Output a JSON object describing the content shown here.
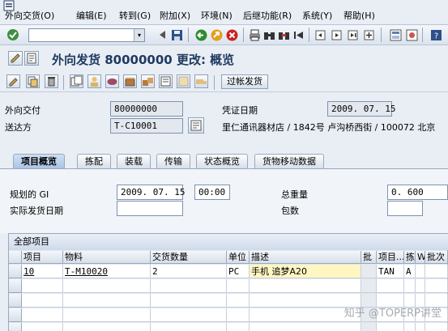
{
  "menu": [
    "外向交货(O)",
    "编辑(E)",
    "转到(G)",
    "附加(X)",
    "环境(N)",
    "后继功能(R)",
    "系统(Y)",
    "帮助(H)"
  ],
  "title": "外向发货 80000000 更改: 概览",
  "app_toolbar": {
    "post_goods_issue": "过帐发货"
  },
  "header": {
    "delivery_label": "外向交付",
    "delivery_value": "80000000",
    "shipto_label": "送达方",
    "shipto_value": "T-C10001",
    "docdate_label": "凭证日期",
    "docdate_value": "2009. 07. 15",
    "address": "里仁通讯器材店 / 1842号 卢沟桥西街 / 100072 北京"
  },
  "tabs": [
    "项目概览",
    "拣配",
    "装载",
    "传输",
    "状态概览",
    "货物移动数据"
  ],
  "overview": {
    "planned_gi_label": "规划的 GI",
    "planned_gi_date": "2009. 07. 15",
    "planned_gi_time": "00:00",
    "actual_gi_label": "实际发货日期",
    "actual_gi_value": "",
    "total_weight_label": "总重量",
    "total_weight_value": "0. 600",
    "packages_label": "包数",
    "packages_value": ""
  },
  "table": {
    "title": "全部项目",
    "columns": [
      "项目",
      "物料",
      "交货数量",
      "单位",
      "描述",
      "批",
      "项目...",
      "拣",
      "W",
      "批次"
    ],
    "rows": [
      [
        "10",
        "T-M10020",
        "2",
        "PC",
        "手机 追梦A20",
        "",
        "TAN",
        "A",
        "",
        ""
      ]
    ]
  },
  "watermark": "知乎 @TOPERP讲堂",
  "colors": {
    "accent": "#1f3a60",
    "background": "#e9eef5",
    "active_tab": "#a9c2e2"
  }
}
